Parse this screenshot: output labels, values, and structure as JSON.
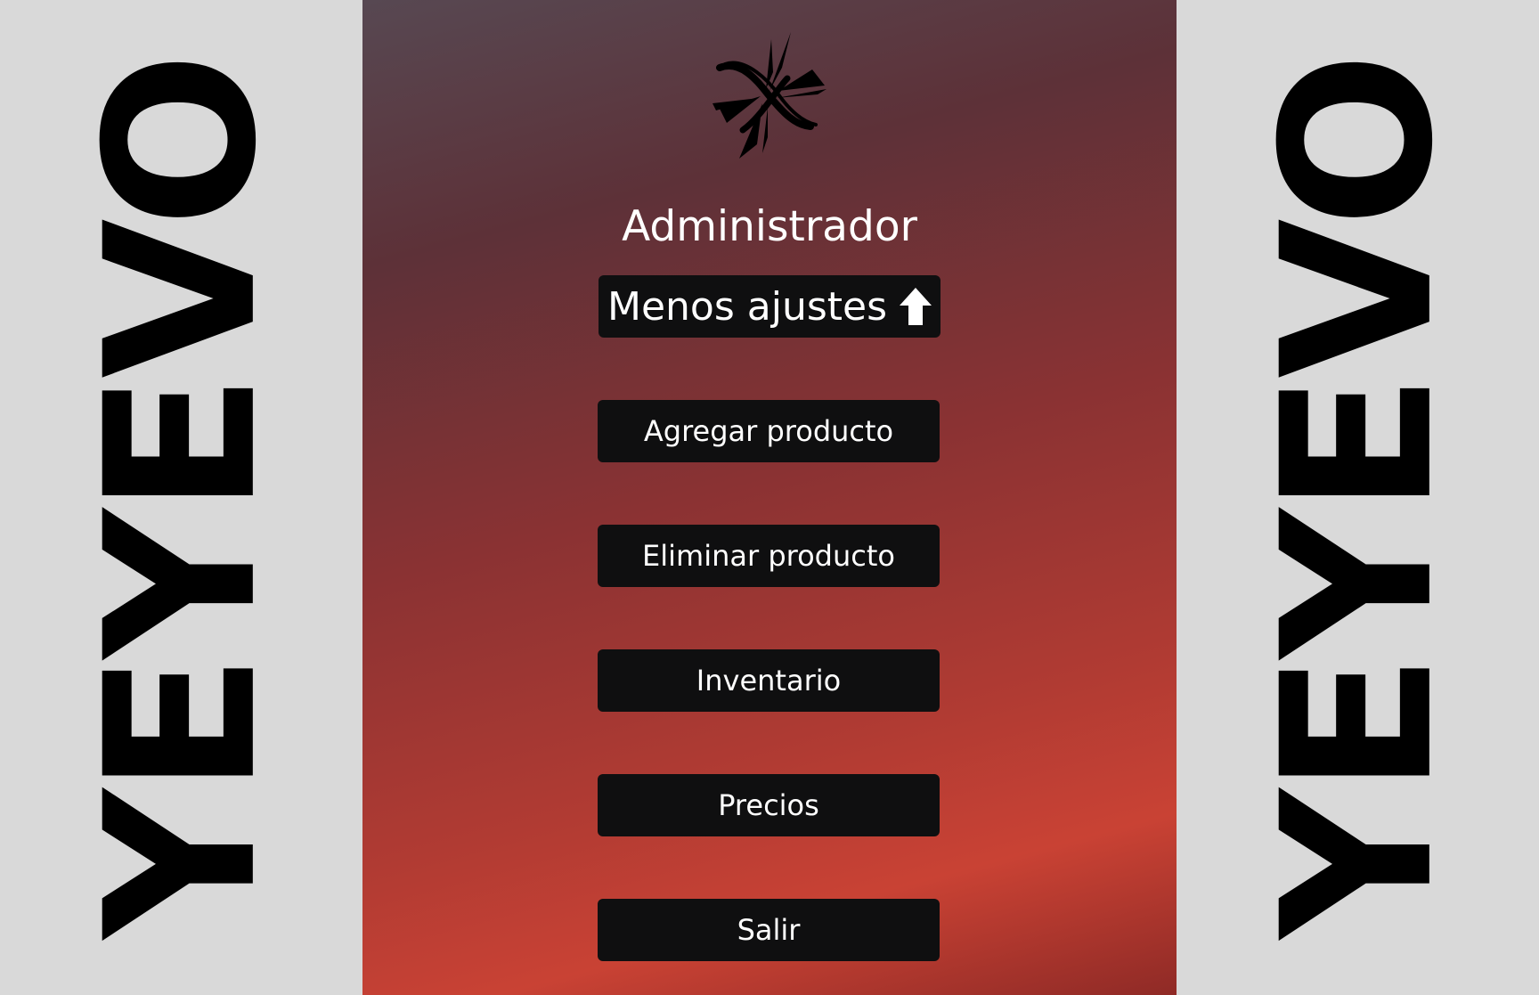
{
  "brand": {
    "side_text": "YEYEVO"
  },
  "panel": {
    "title": "Administrador",
    "toggle_label": "Menos ajustes",
    "toggle_icon": "arrow-up-icon",
    "menu": [
      {
        "label": "Agregar producto"
      },
      {
        "label": "Eliminar producto"
      },
      {
        "label": "Inventario"
      },
      {
        "label": "Precios"
      },
      {
        "label": "Salir"
      }
    ]
  },
  "colors": {
    "background": "#d9d9d9",
    "button": "#0f0f10",
    "button_text": "#ffffff",
    "gradient_top": "#574852",
    "gradient_bottom": "#c94234"
  }
}
